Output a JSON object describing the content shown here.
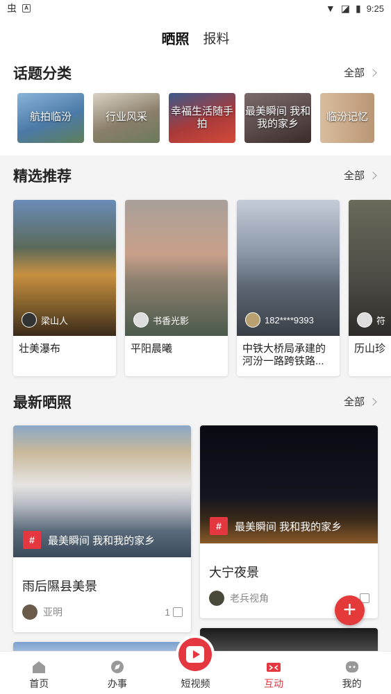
{
  "status": {
    "time": "9:25"
  },
  "header": {
    "tabs": [
      {
        "label": "晒照"
      },
      {
        "label": "报料"
      }
    ]
  },
  "topics": {
    "title": "话题分类",
    "more": "全部",
    "items": [
      {
        "label": "航拍临汾",
        "color": "#4b7aa8"
      },
      {
        "label": "行业风采",
        "color": "#8b7f6a"
      },
      {
        "label": "幸福生活随手拍",
        "color": "#a83a3a"
      },
      {
        "label": "最美瞬间 我和我的家乡",
        "color": "#5a4a4a"
      },
      {
        "label": "临汾记忆",
        "color": "#c9a98a"
      }
    ]
  },
  "featured": {
    "title": "精选推荐",
    "more": "全部",
    "items": [
      {
        "user": "梁山人",
        "title": "壮美瀑布",
        "color": "#7a5a2a"
      },
      {
        "user": "书香光影",
        "title": "平阳晨曦",
        "color": "#8c7f6f"
      },
      {
        "user": "182****9393",
        "title": "中铁大桥局承建的河汾一路跨铁路...",
        "color": "#5b6572"
      },
      {
        "user": "符",
        "title": "历山珍",
        "color": "#4c4a44"
      }
    ]
  },
  "latest": {
    "title": "最新晒照",
    "more": "全部",
    "items": [
      {
        "tag": "最美瞬间 我和我的家乡",
        "title": "雨后隰县美景",
        "user": "亚明",
        "likes": "1"
      },
      {
        "tag": "最美瞬间 我和我的家乡",
        "title": "大宁夜景",
        "user": "老兵视角",
        "likes": ""
      }
    ]
  },
  "fab": {
    "label": "+"
  },
  "bottom_nav": [
    {
      "label": "首页"
    },
    {
      "label": "办事"
    },
    {
      "label": "短视频"
    },
    {
      "label": "互动"
    },
    {
      "label": "我的"
    }
  ]
}
